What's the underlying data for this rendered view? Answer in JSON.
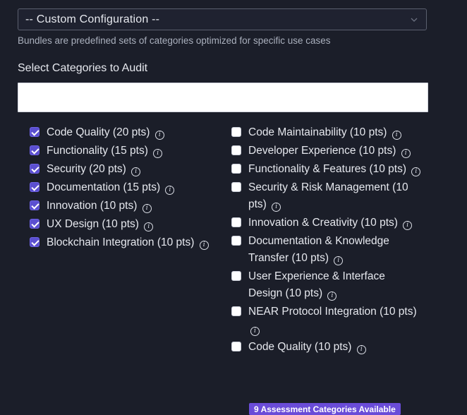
{
  "bundle_select": {
    "value": "-- Custom Configuration --",
    "hint": "Bundles are predefined sets of categories optimized for specific use cases"
  },
  "categories_section": {
    "title": "Select Categories to Audit",
    "search_value": ""
  },
  "left_column": [
    {
      "label": "Code Quality (20 pts)",
      "checked": true
    },
    {
      "label": "Functionality (15 pts)",
      "checked": true
    },
    {
      "label": "Security (20 pts)",
      "checked": true
    },
    {
      "label": "Documentation (15 pts)",
      "checked": true
    },
    {
      "label": "Innovation (10 pts)",
      "checked": true
    },
    {
      "label": "UX Design (10 pts)",
      "checked": true
    },
    {
      "label": "Blockchain Integration (10 pts)",
      "checked": true
    }
  ],
  "right_column": [
    {
      "label": "Code Maintainability (10 pts)",
      "checked": false
    },
    {
      "label": "Developer Experience (10 pts)",
      "checked": false
    },
    {
      "label": "Functionality & Features (10 pts)",
      "checked": false
    },
    {
      "label": "Security & Risk Management (10 pts)",
      "checked": false
    },
    {
      "label": "Innovation & Creativity (10 pts)",
      "checked": false
    },
    {
      "label": "Documentation & Knowledge Transfer (10 pts)",
      "checked": false
    },
    {
      "label": "User Experience & Interface Design (10 pts)",
      "checked": false
    },
    {
      "label": "NEAR Protocol Integration (10 pts)",
      "checked": false
    },
    {
      "label": "Code Quality (10 pts)",
      "checked": false
    }
  ],
  "footer_badge": "9 Assessment Categories Available",
  "info_icon_glyph": "i",
  "colors": {
    "background": "#1b1e29",
    "accent": "#5b4fd0",
    "badge": "#6a4cd8"
  }
}
